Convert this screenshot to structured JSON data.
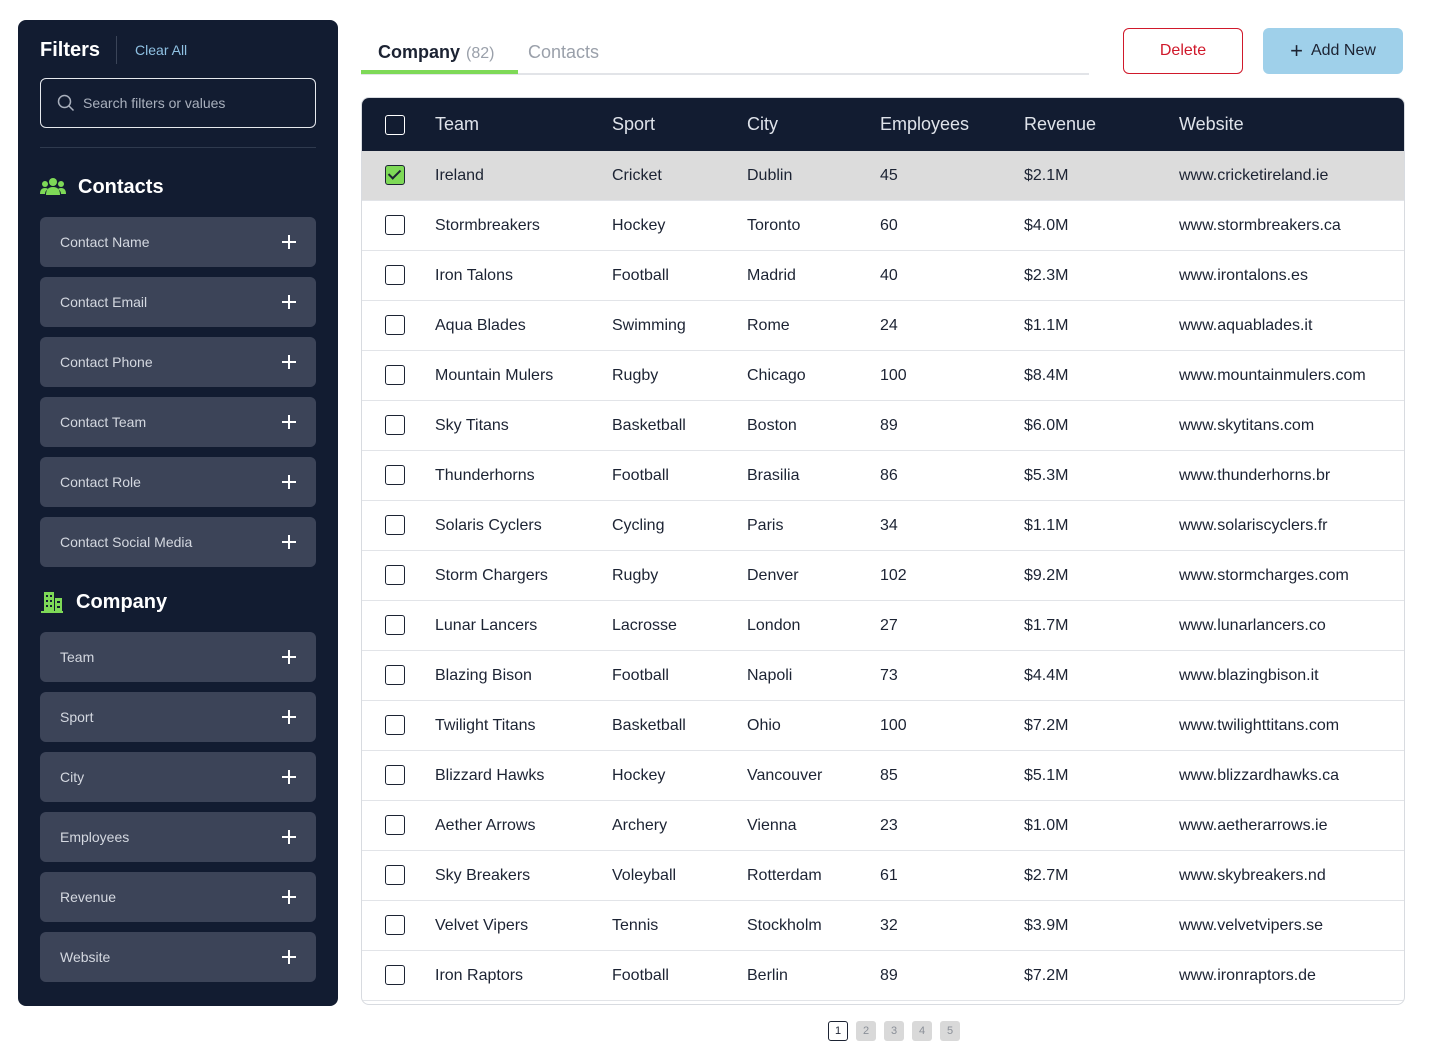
{
  "sidebar": {
    "title": "Filters",
    "clear_all": "Clear All",
    "search_placeholder": "Search filters or values",
    "contacts": {
      "title": "Contacts",
      "items": [
        "Contact Name",
        "Contact Email",
        "Contact Phone",
        "Contact Team",
        "Contact Role",
        "Contact Social Media"
      ]
    },
    "company": {
      "title": "Company",
      "items": [
        "Team",
        "Sport",
        "City",
        "Employees",
        "Revenue",
        "Website"
      ]
    }
  },
  "tabs": {
    "company_label": "Company",
    "company_count": "(82)",
    "contacts_label": "Contacts"
  },
  "actions": {
    "delete": "Delete",
    "add_new": "Add New"
  },
  "colors": {
    "sidebar_bg": "#121c31",
    "accent_green": "#7ed957",
    "delete_red": "#d0192b",
    "add_blue": "#9fd0ea"
  },
  "table": {
    "columns": [
      "Team",
      "Sport",
      "City",
      "Employees",
      "Revenue",
      "Website"
    ],
    "rows": [
      {
        "checked": true,
        "team": "Ireland",
        "sport": "Cricket",
        "city": "Dublin",
        "employees": "45",
        "revenue": "$2.1M",
        "website": "www.cricketireland.ie"
      },
      {
        "checked": false,
        "team": "Stormbreakers",
        "sport": "Hockey",
        "city": "Toronto",
        "employees": "60",
        "revenue": "$4.0M",
        "website": "www.stormbreakers.ca"
      },
      {
        "checked": false,
        "team": "Iron Talons",
        "sport": "Football",
        "city": "Madrid",
        "employees": "40",
        "revenue": "$2.3M",
        "website": "www.irontalons.es"
      },
      {
        "checked": false,
        "team": "Aqua Blades",
        "sport": "Swimming",
        "city": "Rome",
        "employees": "24",
        "revenue": "$1.1M",
        "website": "www.aquablades.it"
      },
      {
        "checked": false,
        "team": "Mountain Mulers",
        "sport": "Rugby",
        "city": "Chicago",
        "employees": "100",
        "revenue": "$8.4M",
        "website": "www.mountainmulers.com"
      },
      {
        "checked": false,
        "team": "Sky Titans",
        "sport": "Basketball",
        "city": "Boston",
        "employees": "89",
        "revenue": "$6.0M",
        "website": "www.skytitans.com"
      },
      {
        "checked": false,
        "team": "Thunderhorns",
        "sport": "Football",
        "city": "Brasilia",
        "employees": "86",
        "revenue": "$5.3M",
        "website": "www.thunderhorns.br"
      },
      {
        "checked": false,
        "team": "Solaris Cyclers",
        "sport": "Cycling",
        "city": "Paris",
        "employees": "34",
        "revenue": "$1.1M",
        "website": "www.solariscyclers.fr"
      },
      {
        "checked": false,
        "team": "Storm Chargers",
        "sport": "Rugby",
        "city": "Denver",
        "employees": "102",
        "revenue": "$9.2M",
        "website": "www.stormcharges.com"
      },
      {
        "checked": false,
        "team": "Lunar Lancers",
        "sport": "Lacrosse",
        "city": "London",
        "employees": "27",
        "revenue": "$1.7M",
        "website": "www.lunarlancers.co"
      },
      {
        "checked": false,
        "team": "Blazing Bison",
        "sport": "Football",
        "city": "Napoli",
        "employees": "73",
        "revenue": "$4.4M",
        "website": "www.blazingbison.it"
      },
      {
        "checked": false,
        "team": "Twilight Titans",
        "sport": "Basketball",
        "city": "Ohio",
        "employees": "100",
        "revenue": "$7.2M",
        "website": "www.twilighttitans.com"
      },
      {
        "checked": false,
        "team": "Blizzard Hawks",
        "sport": "Hockey",
        "city": "Vancouver",
        "employees": "85",
        "revenue": "$5.1M",
        "website": "www.blizzardhawks.ca"
      },
      {
        "checked": false,
        "team": "Aether Arrows",
        "sport": "Archery",
        "city": "Vienna",
        "employees": "23",
        "revenue": "$1.0M",
        "website": "www.aetherarrows.ie"
      },
      {
        "checked": false,
        "team": "Sky Breakers",
        "sport": "Voleyball",
        "city": "Rotterdam",
        "employees": "61",
        "revenue": "$2.7M",
        "website": "www.skybreakers.nd"
      },
      {
        "checked": false,
        "team": "Velvet Vipers",
        "sport": "Tennis",
        "city": "Stockholm",
        "employees": "32",
        "revenue": "$3.9M",
        "website": "www.velvetvipers.se"
      },
      {
        "checked": false,
        "team": "Iron Raptors",
        "sport": "Football",
        "city": "Berlin",
        "employees": "89",
        "revenue": "$7.2M",
        "website": "www.ironraptors.de"
      }
    ]
  },
  "pagination": {
    "pages": [
      "1",
      "2",
      "3",
      "4",
      "5"
    ],
    "current": "1"
  }
}
